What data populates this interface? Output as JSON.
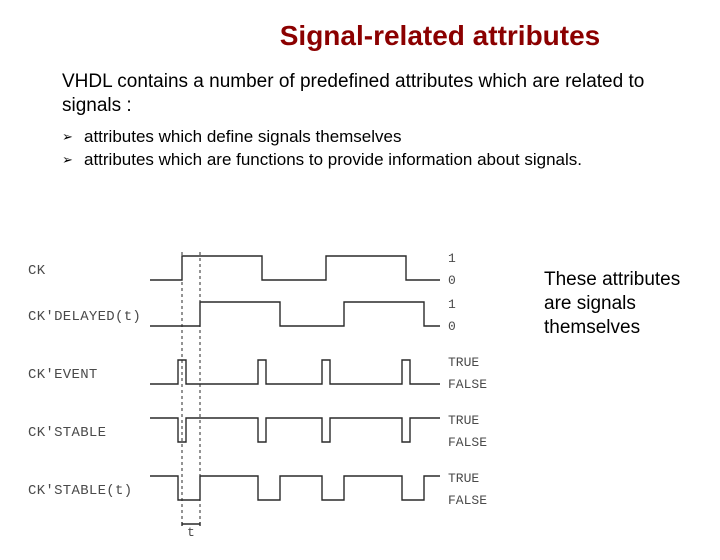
{
  "title": "Signal-related  attributes",
  "intro": "VHDL contains a number of predefined attributes which are related to signals :",
  "bullets": [
    "attributes which define signals themselves",
    "attributes which are functions to provide information about signals."
  ],
  "side_note": "These attributes are signals themselves",
  "signals": {
    "labels": {
      "ck": "CK",
      "ck_delayed": "CK'DELAYED(t)",
      "ck_event": "CK'EVENT",
      "ck_stable": "CK'STABLE",
      "ck_stable_t": "CK'STABLE(t)"
    },
    "value_labels": {
      "one": "1",
      "zero": "0",
      "true": "TRUE",
      "false": "FALSE"
    },
    "t_label": "t"
  },
  "chart_data": {
    "type": "timing-diagram",
    "time_axis": [
      0,
      1,
      2,
      3,
      4,
      5,
      6,
      7,
      8
    ],
    "delay_t": 0.5,
    "rows": [
      {
        "name": "CK",
        "levels": [
          "0",
          "1"
        ],
        "transitions": [
          [
            0,
            0
          ],
          [
            1,
            1
          ],
          [
            3,
            0
          ],
          [
            5,
            1
          ],
          [
            7,
            0
          ]
        ]
      },
      {
        "name": "CK'DELAYED(t)",
        "levels": [
          "0",
          "1"
        ],
        "transitions": [
          [
            0,
            0
          ],
          [
            1.5,
            1
          ],
          [
            3.5,
            0
          ],
          [
            5.5,
            1
          ],
          [
            7.5,
            0
          ]
        ]
      },
      {
        "name": "CK'EVENT",
        "levels": [
          "FALSE",
          "TRUE"
        ],
        "pulses_at": [
          1,
          3,
          5,
          7
        ],
        "pulse_width": 0.15
      },
      {
        "name": "CK'STABLE",
        "levels": [
          "FALSE",
          "TRUE"
        ],
        "notches_at": [
          1,
          3,
          5,
          7
        ],
        "notch_width": 0.15
      },
      {
        "name": "CK'STABLE(t)",
        "levels": [
          "FALSE",
          "TRUE"
        ],
        "low_intervals": [
          [
            1,
            1.5
          ],
          [
            3,
            3.5
          ],
          [
            5,
            5.5
          ],
          [
            7,
            7.5
          ]
        ]
      }
    ]
  }
}
